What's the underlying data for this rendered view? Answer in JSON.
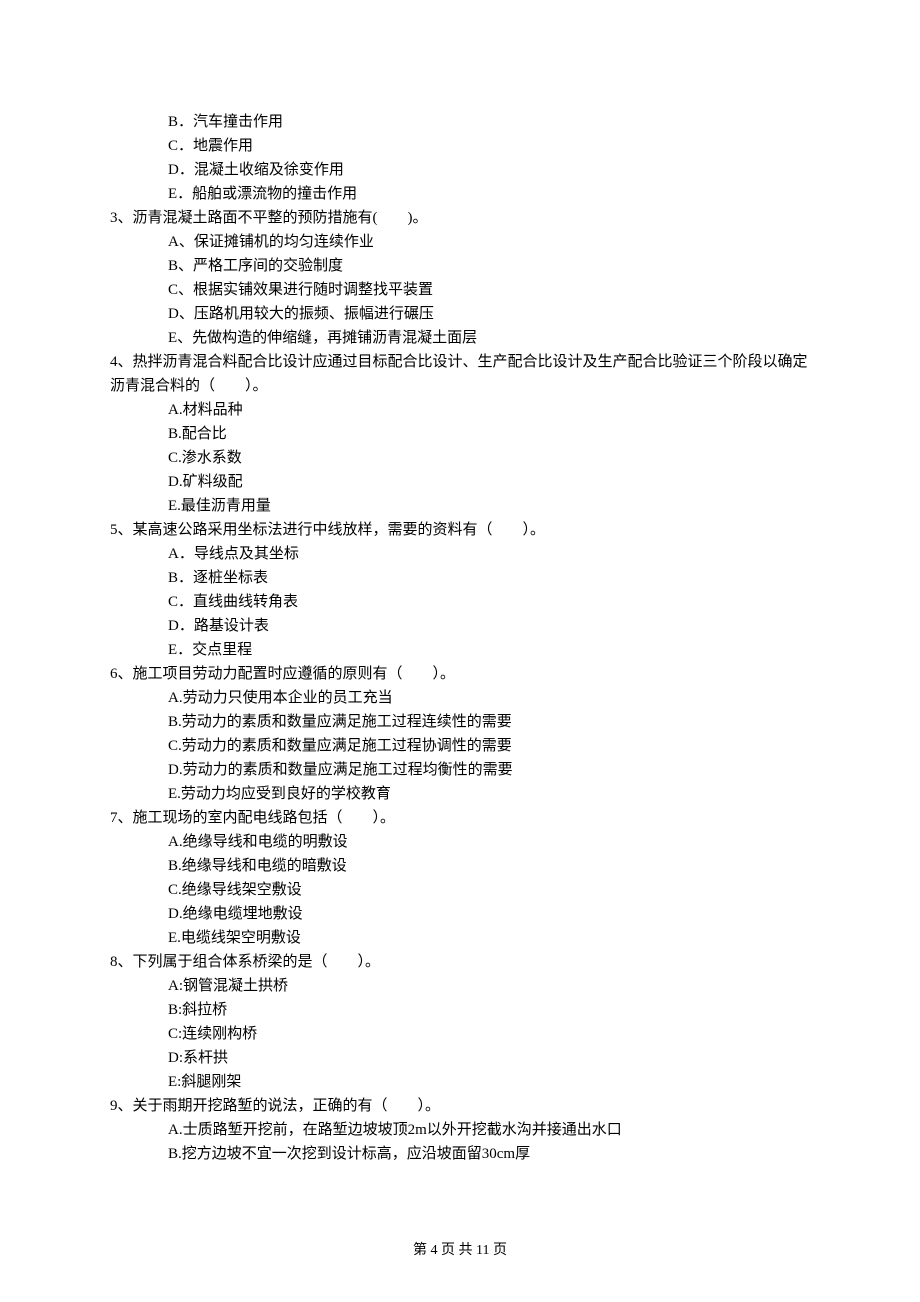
{
  "options_before": [
    "B．汽车撞击作用",
    "C．地震作用",
    "D．混凝土收缩及徐变作用",
    "E．船舶或漂流物的撞击作用"
  ],
  "questions": [
    {
      "stem": "3、沥青混凝土路面不平整的预防措施有(　　)。",
      "options": [
        "A、保证摊铺机的均匀连续作业",
        "B、严格工序间的交验制度",
        "C、根据实铺效果进行随时调整找平装置",
        "D、压路机用较大的振频、振幅进行碾压",
        "E、先做构造的伸缩缝，再摊铺沥青混凝土面层"
      ]
    },
    {
      "stem": "4、热拌沥青混合料配合比设计应通过目标配合比设计、生产配合比设计及生产配合比验证三个阶段以确定沥青混合料的（　　）。",
      "options": [
        "A.材料品种",
        "B.配合比",
        "C.渗水系数",
        "D.矿料级配",
        "E.最佳沥青用量"
      ]
    },
    {
      "stem": "5、某高速公路采用坐标法进行中线放样，需要的资料有（　　）。",
      "options": [
        "A．导线点及其坐标",
        "B．逐桩坐标表",
        "C．直线曲线转角表",
        "D．路基设计表",
        "E．交点里程"
      ]
    },
    {
      "stem": "6、施工项目劳动力配置时应遵循的原则有（　　）。",
      "options": [
        "A.劳动力只使用本企业的员工充当",
        "B.劳动力的素质和数量应满足施工过程连续性的需要",
        "C.劳动力的素质和数量应满足施工过程协调性的需要",
        "D.劳动力的素质和数量应满足施工过程均衡性的需要",
        "E.劳动力均应受到良好的学校教育"
      ]
    },
    {
      "stem": "7、施工现场的室内配电线路包括（　　）。",
      "options": [
        "A.绝缘导线和电缆的明敷设",
        "B.绝缘导线和电缆的暗敷设",
        "C.绝缘导线架空敷设",
        "D.绝缘电缆埋地敷设",
        "E.电缆线架空明敷设"
      ]
    },
    {
      "stem": "8、下列属于组合体系桥梁的是（　　）。",
      "options": [
        "A:钢管混凝土拱桥",
        "B:斜拉桥",
        "C:连续刚构桥",
        "D:系杆拱",
        "E:斜腿刚架"
      ]
    },
    {
      "stem": "9、关于雨期开挖路堑的说法，正确的有（　　）。",
      "options": [
        "A.士质路堑开挖前，在路堑边坡坡顶2m以外开挖截水沟并接通出水口",
        "B.挖方边坡不宜一次挖到设计标高，应沿坡面留30cm厚"
      ]
    }
  ],
  "footer": "第 4 页 共 11 页"
}
